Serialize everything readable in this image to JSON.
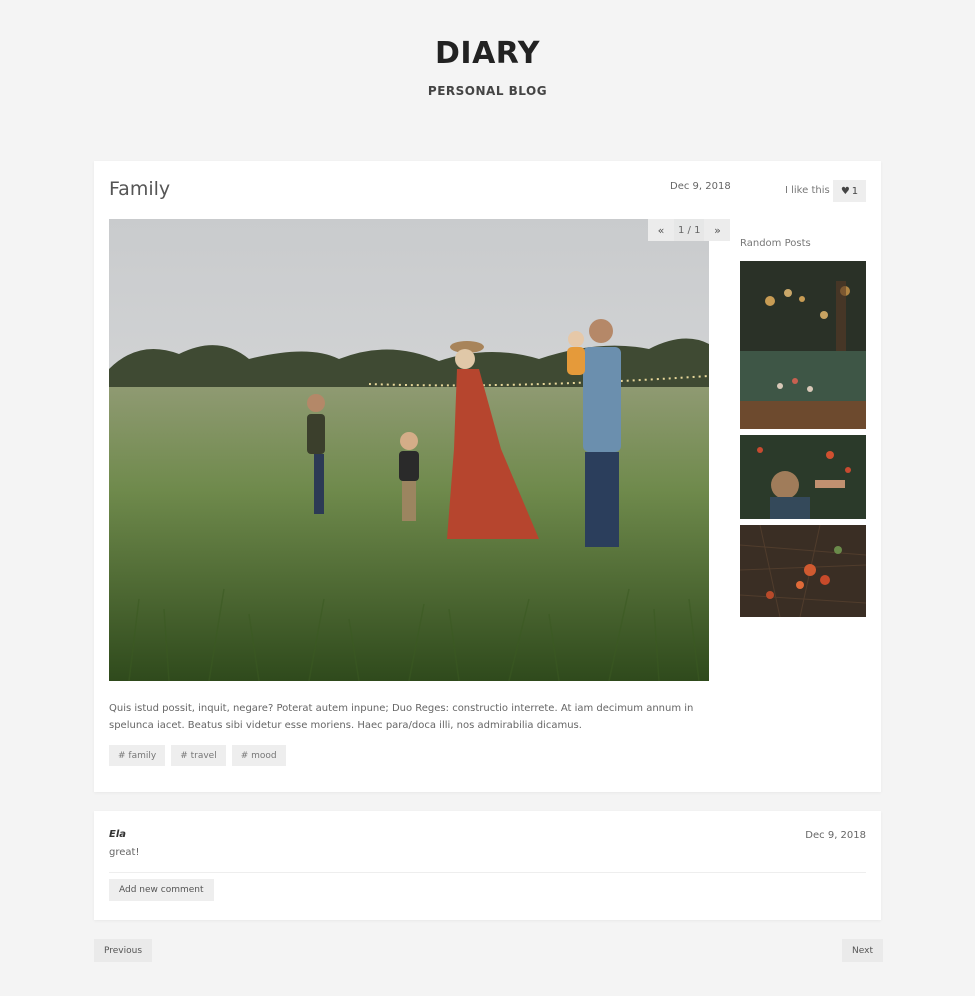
{
  "site": {
    "title": "DIARY",
    "subtitle": "PERSONAL BLOG"
  },
  "post": {
    "title": "Family",
    "date": "Dec 9, 2018",
    "like_label": "I like this",
    "like_count": "1",
    "pager": {
      "prev": "«",
      "counter": "1 / 1",
      "next": "»"
    },
    "text": "Quis istud possit, inquit, negare? Poterat autem inpune; Duo Reges: constructio interrete. At iam decimum annum in spelunca iacet. Beatus sibi videtur esse moriens. Haec para/doca illi, nos admirabilia dicamus.",
    "tags": [
      "# family",
      "# travel",
      "# mood"
    ]
  },
  "sidebar": {
    "random_label": "Random Posts"
  },
  "comment": {
    "author": "Ela",
    "date": "Dec 9, 2018",
    "text": "great!",
    "add_label": "Add new comment"
  },
  "navigation": {
    "previous": "Previous",
    "next": "Next"
  },
  "colors": {
    "background": "#f4f4f4",
    "card": "#ffffff",
    "button": "#eeeeee",
    "title": "#222222"
  }
}
